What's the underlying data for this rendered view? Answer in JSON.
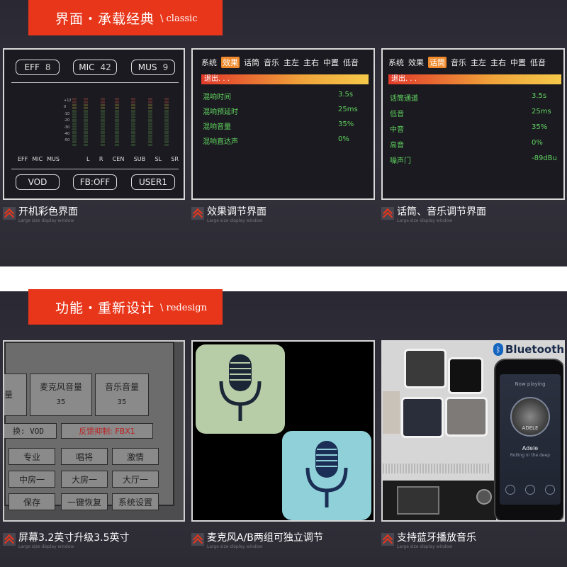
{
  "section1": {
    "banner_main": "界面・承载经典",
    "banner_sub": "\\ classic",
    "panel1": {
      "buttons": [
        {
          "label": "EFF",
          "value": "8"
        },
        {
          "label": "MIC",
          "value": "42"
        },
        {
          "label": "MUS",
          "value": "9"
        }
      ],
      "scale": [
        "+12",
        "0",
        "-10",
        "-20",
        "-30",
        "-40",
        "-50"
      ],
      "left_labels": [
        "EFF",
        "MIC",
        "MUS"
      ],
      "channel_labels": [
        "L",
        "R",
        "CEN",
        "SUB",
        "SL",
        "SR"
      ],
      "bottom_buttons": [
        "VOD",
        "FB:OFF",
        "USER1"
      ]
    },
    "panel2": {
      "tabs": [
        "系统",
        "效果",
        "话筒",
        "音乐",
        "主左",
        "主右",
        "中置",
        "低音"
      ],
      "active_tab": "效果",
      "exit": "退出. . .",
      "rows": [
        {
          "label": "混响时间",
          "value": "3.5s"
        },
        {
          "label": "混响预延时",
          "value": "25ms"
        },
        {
          "label": "混响音量",
          "value": "35%"
        },
        {
          "label": "混响直达声",
          "value": "0%"
        }
      ]
    },
    "panel3": {
      "tabs": [
        "系统",
        "效果",
        "话筒",
        "音乐",
        "主左",
        "主右",
        "中置",
        "低音"
      ],
      "active_tab": "话筒",
      "exit": "退出. . .",
      "rows": [
        {
          "label": "话筒通道",
          "value": "3.5s"
        },
        {
          "label": "低音",
          "value": "25ms"
        },
        {
          "label": "中音",
          "value": "35%"
        },
        {
          "label": "高音",
          "value": "0%"
        },
        {
          "label": "噪声门",
          "value": "-89dBu"
        }
      ]
    },
    "captions": [
      {
        "title": "开机彩色界面",
        "sub": "Large size display window"
      },
      {
        "title": "效果调节界面",
        "sub": "Large size display window"
      },
      {
        "title": "话筒、音乐调节界面",
        "sub": "Large size display window"
      }
    ]
  },
  "section2": {
    "banner_main": "功能・重新设计",
    "banner_sub": "\\ redesign",
    "panel4": {
      "cell_vol_partial": "量",
      "mic_vol_label": "麦克风音量",
      "mic_vol_value": "35",
      "music_vol_label": "音乐音量",
      "music_vol_value": "35",
      "switch_partial": "换: VOD",
      "feedback": "反馈抑制: FBX1",
      "modes": [
        "专业",
        "唱将",
        "激情",
        "中房一",
        "大房一",
        "大厅一",
        "保存",
        "一键恢复",
        "系统设置"
      ]
    },
    "panel6": {
      "bluetooth": "Bluetooth",
      "now_playing": "Now playing",
      "artist": "Adele",
      "song": "Rolling in the deep",
      "album_label": "ADELE"
    },
    "captions": [
      {
        "title": "屏幕3.2英寸升级3.5英寸",
        "sub": "Large size display window"
      },
      {
        "title": "麦克风A/B两组可独立调节",
        "sub": "Large size display window"
      },
      {
        "title": "支持蓝牙播放音乐",
        "sub": "Large size display window"
      }
    ]
  },
  "colors": {
    "accent": "#e8361b",
    "setting_green": "#5fd35f",
    "tab_active": "#f08a2c",
    "mic_a_bg": "#b7cda8",
    "mic_b_bg": "#8fd0d9"
  },
  "icons": [
    "microphone-icon",
    "bluetooth-icon",
    "chevron-icon"
  ]
}
